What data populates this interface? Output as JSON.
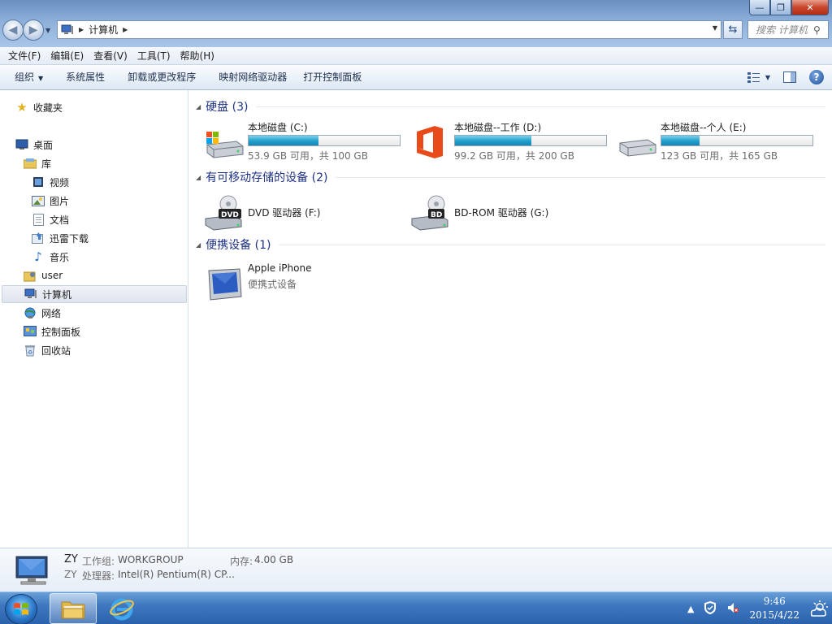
{
  "window": {
    "minimize_glyph": "—",
    "maximize_glyph": "❐",
    "close_glyph": "✕"
  },
  "address": {
    "crumbs": [
      "计算机"
    ],
    "search_placeholder": "搜索 计算机"
  },
  "menu": [
    "文件(F)",
    "编辑(E)",
    "查看(V)",
    "工具(T)",
    "帮助(H)"
  ],
  "commands": {
    "organize": "组织",
    "system_properties": "系统属性",
    "uninstall": "卸载或更改程序",
    "map_drive": "映射网络驱动器",
    "control_panel": "打开控制面板"
  },
  "nav": {
    "favorites": "收藏夹",
    "desktop": "桌面",
    "libraries": "库",
    "videos": "视频",
    "pictures": "图片",
    "documents": "文档",
    "thunder": "迅雷下载",
    "music": "音乐",
    "user": "user",
    "computer": "计算机",
    "network": "网络",
    "control_panel": "控制面板",
    "recycle_bin": "回收站"
  },
  "groups": {
    "hdd": "硬盘 (3)",
    "removable": "有可移动存储的设备 (2)",
    "portable": "便携设备 (1)"
  },
  "drives": {
    "c": {
      "name": "本地磁盘 (C:)",
      "info": "53.9 GB 可用，共 100 GB",
      "used_fraction": 0.461
    },
    "d": {
      "name": "本地磁盘--工作 (D:)",
      "info": "99.2 GB 可用，共 200 GB",
      "used_fraction": 0.504
    },
    "e": {
      "name": "本地磁盘--个人 (E:)",
      "info": "123 GB 可用，共 165 GB",
      "used_fraction": 0.255
    }
  },
  "removable": {
    "f": {
      "name": "DVD 驱动器 (F:)",
      "label": "DVD"
    },
    "g": {
      "name": "BD-ROM 驱动器 (G:)",
      "label": "BD"
    }
  },
  "portable": {
    "name": "Apple iPhone",
    "type": "便携式设备"
  },
  "details": {
    "name": "ZY",
    "workgroup_label": "工作组:",
    "workgroup": "WORKGROUP",
    "memory_label": "内存:",
    "memory": "4.00 GB",
    "name2": "ZY",
    "cpu_label": "处理器:",
    "cpu": "Intel(R) Pentium(R) CP..."
  },
  "taskbar": {
    "time": "9:46",
    "date": "2015/4/22",
    "tray_arrow": "▲"
  }
}
